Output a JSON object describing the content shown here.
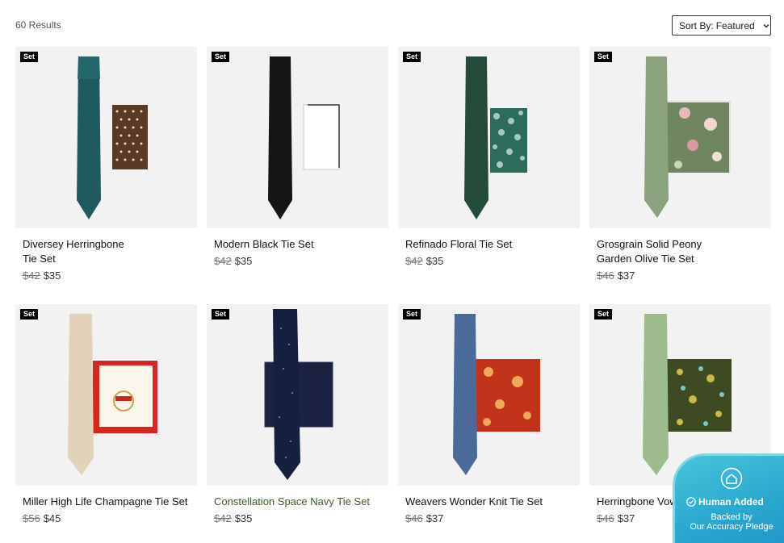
{
  "header": {
    "results": "60 Results",
    "sort_label": "Sort By:",
    "sort_value": "Featured"
  },
  "products": [
    {
      "badge": "Set",
      "title": "Diversey Herringbone Tie Set",
      "old_price": "$42",
      "price": "$35"
    },
    {
      "badge": "Set",
      "title": "Modern Black Tie Set",
      "old_price": "$42",
      "price": "$35"
    },
    {
      "badge": "Set",
      "title": "Refinado Floral Tie Set",
      "old_price": "$42",
      "price": "$35"
    },
    {
      "badge": "Set",
      "title": "Grosgrain Solid Peony Garden Olive Tie Set",
      "old_price": "$46",
      "price": "$37"
    },
    {
      "badge": "Set",
      "title": "Miller High Life Champagne Tie Set",
      "old_price": "$56",
      "price": "$45"
    },
    {
      "badge": "Set",
      "title": "Constellation Space Navy Tie Set",
      "old_price": "$42",
      "price": "$35"
    },
    {
      "badge": "Set",
      "title": "Weavers Wonder Knit Tie Set",
      "old_price": "$46",
      "price": "$37"
    },
    {
      "badge": "Set",
      "title": "Herringbone Vow T",
      "old_price": "$46",
      "price": "$37"
    }
  ],
  "pledge": {
    "title": "Human Added",
    "subtitle_1": "Backed by",
    "subtitle_2": "Our Accuracy Pledge"
  },
  "colors": {
    "tile_bg": "#f2f2f2",
    "badge_bg": "#000000",
    "pledge_bg": "#2aa6cf"
  }
}
